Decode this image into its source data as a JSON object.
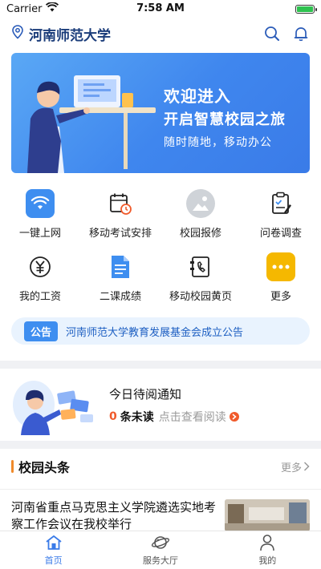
{
  "status": {
    "carrier": "Carrier",
    "time": "7:58 AM"
  },
  "header": {
    "title": "河南师范大学"
  },
  "banner": {
    "line1": "欢迎进入",
    "line2": "开启智慧校园之旅",
    "line3": "随时随地，移动办公"
  },
  "grid": [
    {
      "label": "一键上网",
      "icon": "wifi-icon",
      "color": "#3e8ef0"
    },
    {
      "label": "移动考试安排",
      "icon": "calendar-clock-icon",
      "color": "#222222"
    },
    {
      "label": "校园报修",
      "icon": "repair-icon",
      "color": "#cfd3d8"
    },
    {
      "label": "问卷调查",
      "icon": "clipboard-check-icon",
      "color": "#222222"
    },
    {
      "label": "我的工资",
      "icon": "yen-icon",
      "color": "#222222"
    },
    {
      "label": "二课成绩",
      "icon": "document-icon",
      "color": "#3e8ef0"
    },
    {
      "label": "移动校园黄页",
      "icon": "phone-book-icon",
      "color": "#222222"
    },
    {
      "label": "更多",
      "icon": "more-icon",
      "color": "#f5b800"
    }
  ],
  "notice": {
    "tag": "公告",
    "text": "河南师范大学教育发展基金会成立公告"
  },
  "pending": {
    "title": "今日待阅通知",
    "count": "0",
    "unread": "条未读",
    "link": "点击查看阅读"
  },
  "news": {
    "title": "校园头条",
    "more": "更多",
    "items": [
      {
        "text": "河南省重点马克思主义学院遴选实地考察工作会议在我校举行"
      }
    ]
  },
  "tabs": [
    {
      "label": "首页",
      "active": true
    },
    {
      "label": "服务大厅",
      "active": false
    },
    {
      "label": "我的",
      "active": false
    }
  ],
  "colors": {
    "accent": "#3a7be8",
    "orange": "#f05a2b"
  }
}
